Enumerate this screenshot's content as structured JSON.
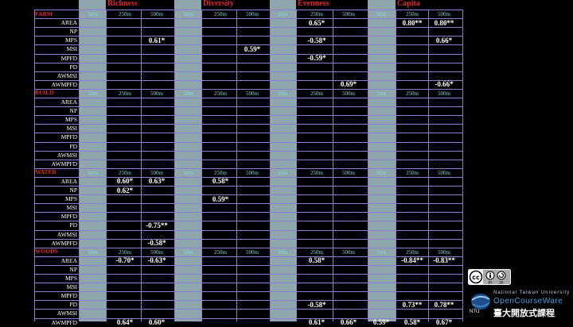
{
  "groups": [
    "Richness",
    "Diversity",
    "Evenness",
    "Capita"
  ],
  "sections": [
    {
      "name": "FARM",
      "columns": [
        "50m",
        "250m",
        "500m",
        "50m",
        "250m",
        "500m",
        "50m",
        "250m",
        "500m",
        "50m",
        "250m",
        "500m"
      ],
      "rows": [
        {
          "label": "AREA",
          "cells": [
            "",
            "",
            "",
            "",
            "",
            "",
            "",
            "0.65*",
            "",
            "",
            "0.80**",
            "0.80**"
          ]
        },
        {
          "label": "NP",
          "cells": [
            "",
            "",
            "",
            "",
            "",
            "",
            "",
            "",
            "",
            "",
            "",
            ""
          ]
        },
        {
          "label": "MPS",
          "cells": [
            "",
            "",
            "0.61*",
            "",
            "",
            "",
            "",
            "-0.58*",
            "",
            "",
            "",
            "0.66*"
          ]
        },
        {
          "label": "MSI",
          "cells": [
            "",
            "",
            "",
            "",
            "",
            "0.59*",
            "",
            "",
            "",
            "",
            "",
            ""
          ]
        },
        {
          "label": "MPFD",
          "cells": [
            "",
            "",
            "",
            "",
            "",
            "",
            "",
            "-0.59*",
            "",
            "",
            "",
            ""
          ]
        },
        {
          "label": "PD",
          "cells": [
            "",
            "",
            "",
            "",
            "",
            "",
            "",
            "",
            "",
            "",
            "",
            ""
          ]
        },
        {
          "label": "AWMSI",
          "cells": [
            "",
            "",
            "",
            "",
            "",
            "",
            "",
            "",
            "",
            "",
            "",
            ""
          ]
        },
        {
          "label": "AWMPFD",
          "cells": [
            "",
            "",
            "",
            "",
            "",
            "",
            "",
            "",
            "0.69*",
            "",
            "",
            "-0.66*"
          ]
        }
      ]
    },
    {
      "name": "BUILD",
      "columns": [
        "50m",
        "250m",
        "500m",
        "50m",
        "250m",
        "500m",
        "50m",
        "250m",
        "500m",
        "50m",
        "250m",
        "500m"
      ],
      "rows": [
        {
          "label": "AREA",
          "cells": [
            "",
            "",
            "",
            "",
            "",
            "",
            "",
            "",
            "",
            "",
            "",
            ""
          ]
        },
        {
          "label": "NP",
          "cells": [
            "",
            "",
            "",
            "",
            "",
            "",
            "",
            "",
            "",
            "",
            "",
            ""
          ]
        },
        {
          "label": "MPS",
          "cells": [
            "",
            "",
            "",
            "",
            "",
            "",
            "",
            "",
            "",
            "",
            "",
            ""
          ]
        },
        {
          "label": "MSI",
          "cells": [
            "",
            "",
            "",
            "",
            "",
            "",
            "",
            "",
            "",
            "",
            "",
            ""
          ]
        },
        {
          "label": "MPFD",
          "cells": [
            "",
            "",
            "",
            "",
            "",
            "",
            "",
            "",
            "",
            "",
            "",
            ""
          ]
        },
        {
          "label": "PD",
          "cells": [
            "",
            "",
            "",
            "",
            "",
            "",
            "",
            "",
            "",
            "",
            "",
            ""
          ]
        },
        {
          "label": "AWMSI",
          "cells": [
            "",
            "",
            "",
            "",
            "",
            "",
            "",
            "",
            "",
            "",
            "",
            ""
          ]
        },
        {
          "label": "AWMPFD",
          "cells": [
            "",
            "",
            "",
            "",
            "",
            "",
            "",
            "",
            "",
            "",
            "",
            ""
          ]
        }
      ]
    },
    {
      "name": "WATER",
      "columns": [
        "50m",
        "250m",
        "500m",
        "50m",
        "250m",
        "500m",
        "50m",
        "250m",
        "500m",
        "50m",
        "250m",
        "500m"
      ],
      "rows": [
        {
          "label": "AREA",
          "cells": [
            "",
            "0.60*",
            "0.63*",
            "",
            "0.58*",
            "",
            "",
            "",
            "",
            "",
            "",
            ""
          ]
        },
        {
          "label": "NP",
          "cells": [
            "",
            "0.62*",
            "",
            "",
            "",
            "",
            "",
            "",
            "",
            "",
            "",
            ""
          ]
        },
        {
          "label": "MPS",
          "cells": [
            "",
            "",
            "",
            "",
            "0.59*",
            "",
            "",
            "",
            "",
            "",
            "",
            ""
          ]
        },
        {
          "label": "MSI",
          "cells": [
            "",
            "",
            "",
            "",
            "",
            "",
            "",
            "",
            "",
            "",
            "",
            ""
          ]
        },
        {
          "label": "MPFD",
          "cells": [
            "",
            "",
            "",
            "",
            "",
            "",
            "",
            "",
            "",
            "",
            "",
            ""
          ]
        },
        {
          "label": "PD",
          "cells": [
            "",
            "",
            "-0.75**",
            "",
            "",
            "",
            "",
            "",
            "",
            "",
            "",
            ""
          ]
        },
        {
          "label": "AWMSI",
          "cells": [
            "",
            "",
            "",
            "",
            "",
            "",
            "",
            "",
            "",
            "",
            "",
            ""
          ]
        },
        {
          "label": "AWMPFD",
          "cells": [
            "",
            "",
            "-0.58*",
            "",
            "",
            "",
            "",
            "",
            "",
            "",
            "",
            ""
          ]
        }
      ]
    },
    {
      "name": "WOODS",
      "columns": [
        "50m",
        "250m",
        "500m",
        "50m",
        "250m",
        "500m",
        "50m",
        "250m",
        "500m",
        "50m",
        "250m",
        "500m"
      ],
      "rows": [
        {
          "label": "AREA",
          "cells": [
            "",
            "-0.70*",
            "-0.63*",
            "",
            "",
            "",
            "",
            "0.58*",
            "",
            "",
            "-0.84**",
            "-0.83**"
          ]
        },
        {
          "label": "NP",
          "cells": [
            "",
            "",
            "",
            "",
            "",
            "",
            "",
            "",
            "",
            "",
            "",
            ""
          ]
        },
        {
          "label": "MPS",
          "cells": [
            "",
            "",
            "",
            "",
            "",
            "",
            "",
            "",
            "",
            "",
            "",
            ""
          ]
        },
        {
          "label": "MSI",
          "cells": [
            "",
            "",
            "",
            "",
            "",
            "",
            "",
            "",
            "",
            "",
            "",
            ""
          ]
        },
        {
          "label": "MPFD",
          "cells": [
            "",
            "",
            "",
            "",
            "",
            "",
            "",
            "",
            "",
            "",
            "",
            ""
          ]
        },
        {
          "label": "PD",
          "cells": [
            "",
            "",
            "",
            "",
            "",
            "",
            "",
            "-0.58*",
            "",
            "",
            "0.73**",
            "0.78**"
          ]
        },
        {
          "label": "AWMSI",
          "cells": [
            "",
            "",
            "",
            "",
            "",
            "",
            "",
            "",
            "",
            "",
            "",
            ""
          ]
        },
        {
          "label": "AWMPFD",
          "cells": [
            "",
            "0.64*",
            "0.60*",
            "",
            "",
            "",
            "",
            "0.61*",
            "0.66*",
            "0.59*",
            "0.58*",
            "0.67*"
          ]
        }
      ]
    }
  ],
  "license": {
    "badge": "cc",
    "terms": [
      "BY",
      "SA"
    ]
  },
  "branding": {
    "line1": "National Taiwan University",
    "line2": "OpenCourseWare",
    "line3": "臺大開放式課程",
    "short": "NTU"
  },
  "colors": {
    "background": "#000000",
    "band": "#8fa7ac",
    "grid": "#8a7fd0",
    "section_title": "#e0262c",
    "column_header": "#7ed3df",
    "value": "#ffffff"
  }
}
